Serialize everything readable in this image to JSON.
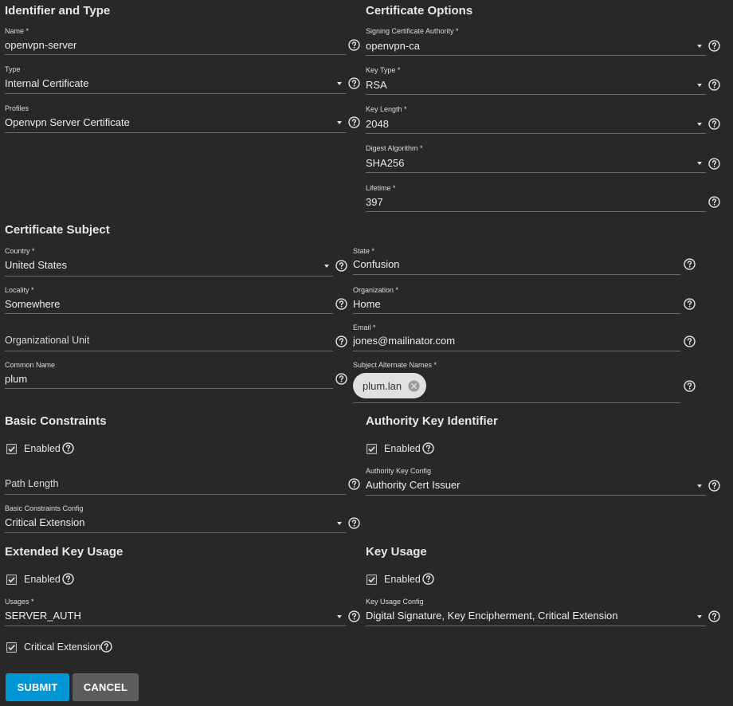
{
  "sections": {
    "identifier": "Identifier and Type",
    "cert_options": "Certificate Options",
    "cert_subject": "Certificate Subject",
    "basic_constraints": "Basic Constraints",
    "authority_key": "Authority Key Identifier",
    "extended_key_usage": "Extended Key Usage",
    "key_usage": "Key Usage"
  },
  "identifier": {
    "name": {
      "label": "Name *",
      "value": "openvpn-server"
    },
    "type": {
      "label": "Type",
      "value": "Internal Certificate"
    },
    "profiles": {
      "label": "Profiles",
      "value": "Openvpn Server Certificate"
    }
  },
  "cert_options": {
    "signing_ca": {
      "label": "Signing Certificate Authority *",
      "value": "openvpn-ca"
    },
    "key_type": {
      "label": "Key Type *",
      "value": "RSA"
    },
    "key_length": {
      "label": "Key Length *",
      "value": "2048"
    },
    "digest": {
      "label": "Digest Algorithm *",
      "value": "SHA256"
    },
    "lifetime": {
      "label": "Lifetime *",
      "value": "397"
    }
  },
  "subject": {
    "country": {
      "label": "Country *",
      "value": "United States"
    },
    "state": {
      "label": "State *",
      "value": "Confusion"
    },
    "locality": {
      "label": "Locality *",
      "value": "Somewhere"
    },
    "organization": {
      "label": "Organization *",
      "value": "Home"
    },
    "org_unit": {
      "placeholder": "Organizational Unit"
    },
    "email": {
      "label": "Email *",
      "value": "jones@mailinator.com"
    },
    "common_name": {
      "label": "Common Name",
      "value": "plum"
    },
    "san": {
      "label": "Subject Alternate Names *",
      "chips": [
        "plum.lan"
      ]
    }
  },
  "basic_constraints": {
    "enabled_label": "Enabled",
    "enabled": true,
    "path_length": {
      "placeholder": "Path Length"
    },
    "config": {
      "label": "Basic Constraints Config",
      "value": "Critical Extension"
    }
  },
  "authority_key": {
    "enabled_label": "Enabled",
    "enabled": true,
    "config": {
      "label": "Authority Key Config",
      "value": "Authority Cert Issuer"
    }
  },
  "extended_key_usage": {
    "enabled_label": "Enabled",
    "enabled": true,
    "usages": {
      "label": "Usages *",
      "value": "SERVER_AUTH"
    },
    "critical_label": "Critical Extension",
    "critical": true
  },
  "key_usage": {
    "enabled_label": "Enabled",
    "enabled": true,
    "config": {
      "label": "Key Usage Config",
      "value": "Digital Signature, Key Encipherment, Critical Extension"
    }
  },
  "actions": {
    "submit": "SUBMIT",
    "cancel": "CANCEL"
  },
  "colors": {
    "background": "#282828",
    "primary": "#0095d5",
    "secondary_button": "#5d5d5d",
    "chip": "#e0e0e0"
  }
}
